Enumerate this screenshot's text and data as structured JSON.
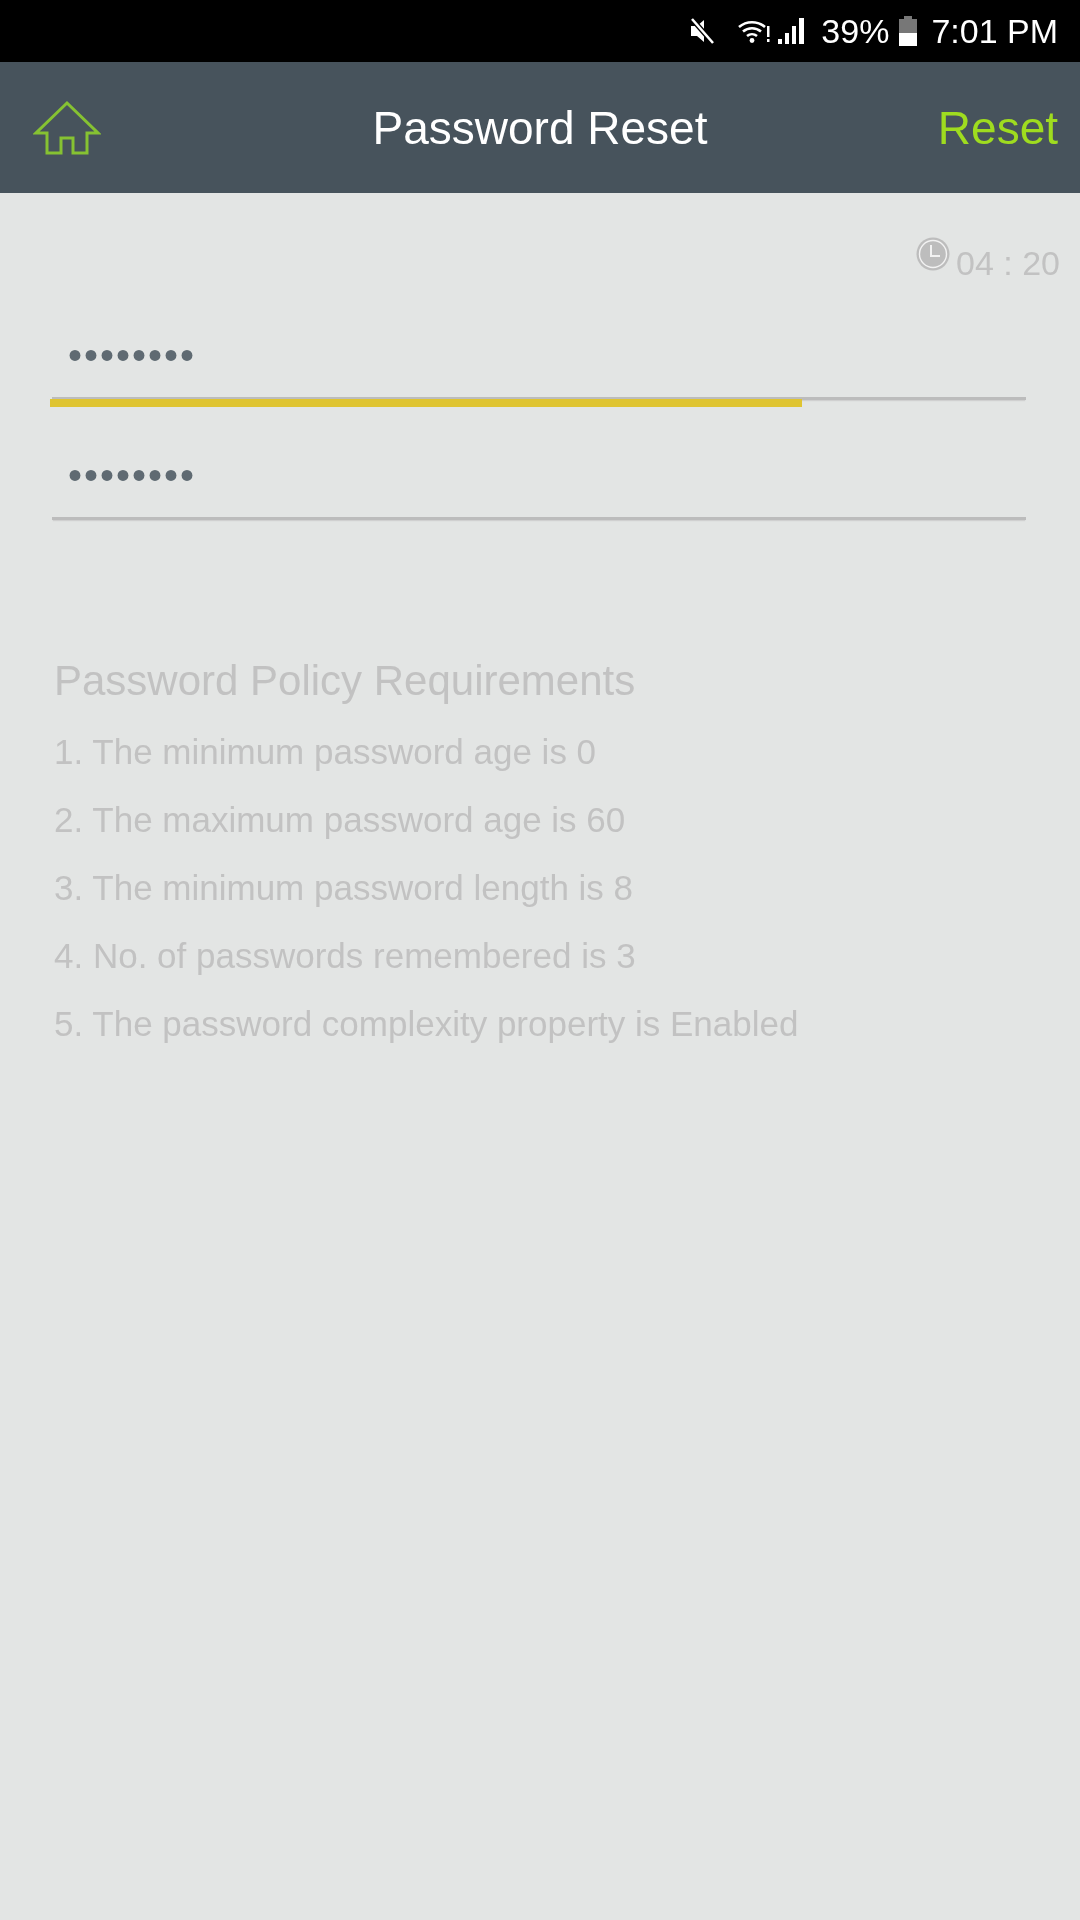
{
  "status_bar": {
    "battery": "39%",
    "time": "7:01 PM"
  },
  "header": {
    "title": "Password Reset",
    "action": "Reset"
  },
  "timer": {
    "text": "04 : 20"
  },
  "fields": [
    {
      "value": "••••••••",
      "strength": {
        "level": 0.77
      }
    },
    {
      "value": "••••••••"
    }
  ],
  "policy": {
    "title": "Password Policy Requirements",
    "items": [
      "1. The minimum password age is 0",
      "2. The maximum password age is 60",
      "3. The minimum password length is 8",
      "4. No. of passwords remembered is 3",
      "5. The password complexity property is Enabled"
    ]
  }
}
